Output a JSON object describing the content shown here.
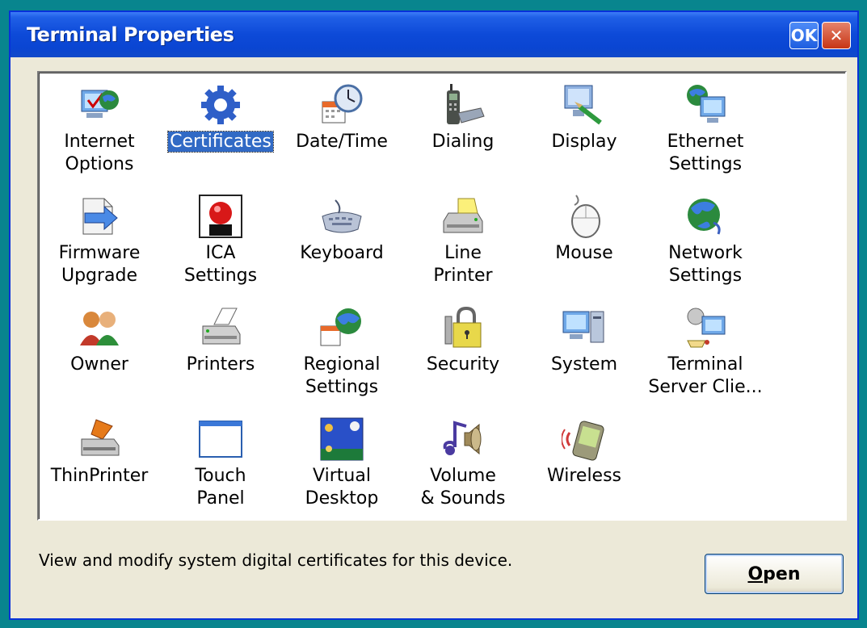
{
  "window": {
    "title": "Terminal Properties",
    "ok_label": "OK",
    "close_label": "✕"
  },
  "items": [
    {
      "label": "Internet Options",
      "icon": "internet-options-icon",
      "selected": false
    },
    {
      "label": "Certificates",
      "icon": "certificates-icon",
      "selected": true
    },
    {
      "label": "Date/Time",
      "icon": "date-time-icon",
      "selected": false
    },
    {
      "label": "Dialing",
      "icon": "dialing-icon",
      "selected": false
    },
    {
      "label": "Display",
      "icon": "display-icon",
      "selected": false
    },
    {
      "label": "Ethernet Settings",
      "icon": "ethernet-settings-icon",
      "selected": false
    },
    {
      "label": "Firmware Upgrade",
      "icon": "firmware-upgrade-icon",
      "selected": false
    },
    {
      "label": "ICA Settings",
      "icon": "ica-settings-icon",
      "selected": false
    },
    {
      "label": "Keyboard",
      "icon": "keyboard-icon",
      "selected": false
    },
    {
      "label": "Line Printer",
      "icon": "line-printer-icon",
      "selected": false
    },
    {
      "label": "Mouse",
      "icon": "mouse-icon",
      "selected": false
    },
    {
      "label": "Network Settings",
      "icon": "network-settings-icon",
      "selected": false
    },
    {
      "label": "Owner",
      "icon": "owner-icon",
      "selected": false
    },
    {
      "label": "Printers",
      "icon": "printers-icon",
      "selected": false
    },
    {
      "label": "Regional Settings",
      "icon": "regional-settings-icon",
      "selected": false
    },
    {
      "label": "Security",
      "icon": "security-icon",
      "selected": false
    },
    {
      "label": "System",
      "icon": "system-icon",
      "selected": false
    },
    {
      "label": "Terminal Server Clie...",
      "icon": "terminal-server-client-icon",
      "selected": false
    },
    {
      "label": "ThinPrinter",
      "icon": "thinprinter-icon",
      "selected": false
    },
    {
      "label": "Touch Panel",
      "icon": "touch-panel-icon",
      "selected": false
    },
    {
      "label": "Virtual Desktop",
      "icon": "virtual-desktop-icon",
      "selected": false
    },
    {
      "label": "Volume & Sounds",
      "icon": "volume-sounds-icon",
      "selected": false
    },
    {
      "label": "Wireless",
      "icon": "wireless-icon",
      "selected": false
    }
  ],
  "status_text": "View and modify system digital certificates for this device.",
  "open_button": {
    "mnemonic": "O",
    "rest": "pen"
  }
}
